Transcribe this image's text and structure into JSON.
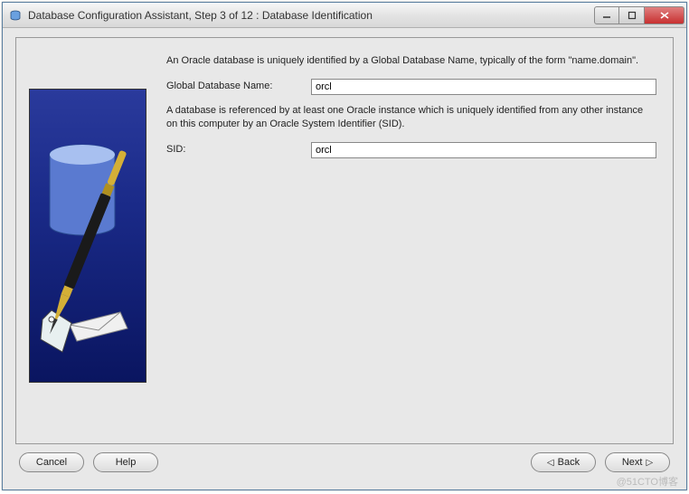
{
  "window": {
    "title": "Database Configuration Assistant, Step 3 of 12 : Database Identification"
  },
  "content": {
    "intro": "An Oracle database is uniquely identified by a Global Database Name, typically of the form \"name.domain\".",
    "gdn_label": "Global Database Name:",
    "gdn_value": "orcl",
    "sid_intro": "A database is referenced by at least one Oracle instance which is uniquely identified from any other instance on this computer by an Oracle System Identifier (SID).",
    "sid_label": "SID:",
    "sid_value": "orcl"
  },
  "buttons": {
    "cancel": "Cancel",
    "help": "Help",
    "back": "Back",
    "next": "Next"
  },
  "watermark": "@51CTO博客"
}
